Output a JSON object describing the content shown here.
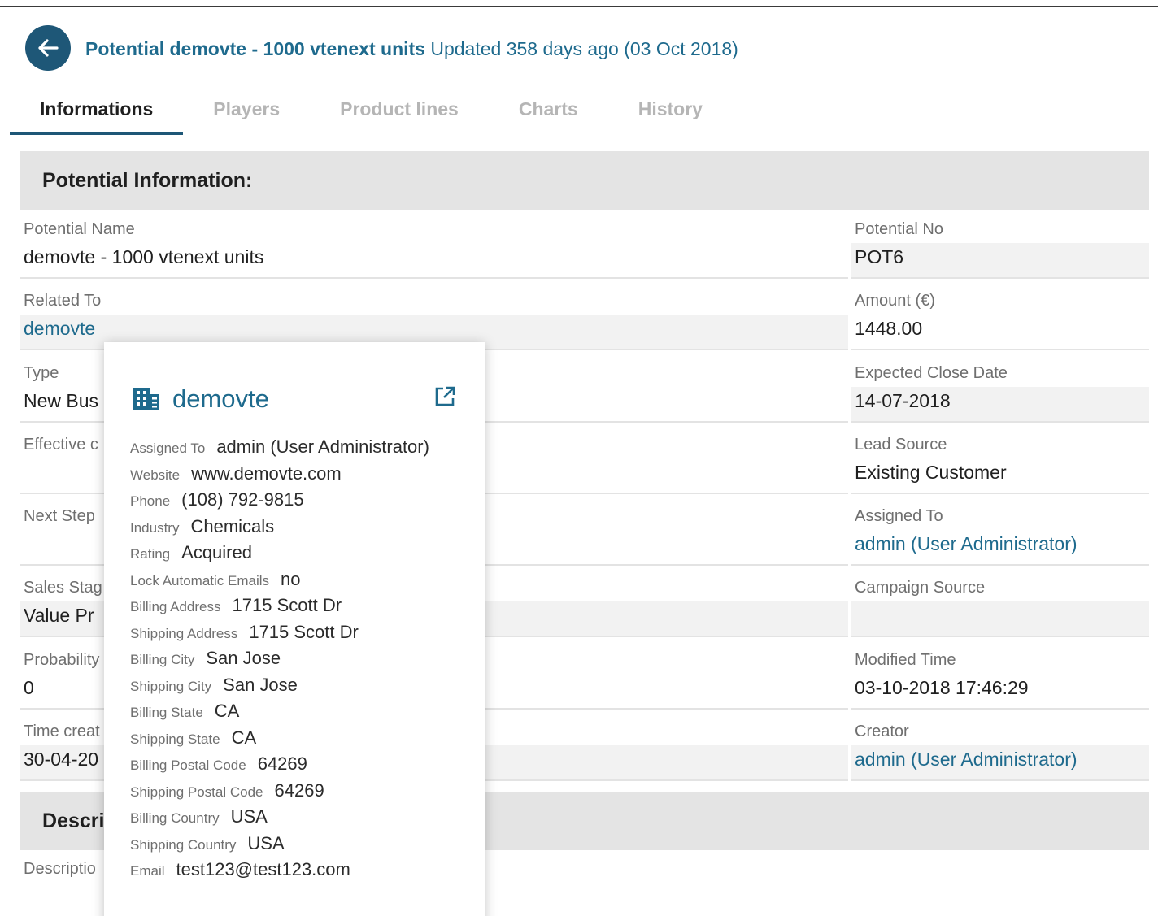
{
  "header": {
    "record_name": "Potential demovte - 1000 vtenext units",
    "updated_text": "Updated 358 days ago (03 Oct 2018)"
  },
  "tabs": [
    {
      "label": "Informations",
      "active": true
    },
    {
      "label": "Players",
      "active": false
    },
    {
      "label": "Product lines",
      "active": false
    },
    {
      "label": "Charts",
      "active": false
    },
    {
      "label": "History",
      "active": false
    }
  ],
  "sections": {
    "potential_info": "Potential Information:",
    "description": "Descri"
  },
  "left_fields": {
    "potential_name": {
      "label": "Potential Name",
      "value": "demovte - 1000 vtenext units"
    },
    "related_to": {
      "label": "Related To",
      "value": "demovte"
    },
    "type": {
      "label": "Type",
      "value": "New Bus"
    },
    "effective": {
      "label": "Effective c",
      "value": ""
    },
    "next_step": {
      "label": "Next Step",
      "value": ""
    },
    "sales_stage": {
      "label": "Sales Stag",
      "value": "Value Pr"
    },
    "probability": {
      "label": "Probability",
      "value": "0"
    },
    "time_created": {
      "label": "Time creat",
      "value": "30-04-20"
    }
  },
  "right_fields": {
    "potential_no": {
      "label": "Potential No",
      "value": "POT6"
    },
    "amount": {
      "label": "Amount (€)",
      "value": "1448.00"
    },
    "expected_close": {
      "label": "Expected Close Date",
      "value": "14-07-2018"
    },
    "lead_source": {
      "label": "Lead Source",
      "value": "Existing Customer"
    },
    "assigned_to": {
      "label": "Assigned To",
      "value": "admin (User Administrator)"
    },
    "campaign_source": {
      "label": "Campaign Source",
      "value": ""
    },
    "modified_time": {
      "label": "Modified Time",
      "value": "03-10-2018 17:46:29"
    },
    "creator": {
      "label": "Creator",
      "value": "admin (User Administrator)"
    }
  },
  "description_label": "Descriptio",
  "popover": {
    "title": "demovte",
    "rows": [
      {
        "key": "Assigned To",
        "value": "admin (User Administrator)"
      },
      {
        "key": "Website",
        "value": "www.demovte.com"
      },
      {
        "key": "Phone",
        "value": "(108) 792-9815"
      },
      {
        "key": "Industry",
        "value": "Chemicals"
      },
      {
        "key": "Rating",
        "value": "Acquired"
      },
      {
        "key": "Lock Automatic Emails",
        "value": "no"
      },
      {
        "key": "Billing Address",
        "value": "1715 Scott Dr"
      },
      {
        "key": "Shipping Address",
        "value": "1715 Scott Dr"
      },
      {
        "key": "Billing City",
        "value": "San Jose"
      },
      {
        "key": "Shipping City",
        "value": "San Jose"
      },
      {
        "key": "Billing State",
        "value": "CA"
      },
      {
        "key": "Shipping State",
        "value": "CA"
      },
      {
        "key": "Billing Postal Code",
        "value": "64269"
      },
      {
        "key": "Shipping Postal Code",
        "value": "64269"
      },
      {
        "key": "Billing Country",
        "value": "USA"
      },
      {
        "key": "Shipping Country",
        "value": "USA"
      },
      {
        "key": "Email",
        "value": "test123@test123.com"
      }
    ]
  },
  "icons": {
    "back": "arrow-left-icon",
    "building": "building-icon",
    "open": "open-external-icon"
  },
  "colors": {
    "primary": "#1e5777",
    "link": "#1e6a8d",
    "section_bg": "#e4e4e4"
  }
}
